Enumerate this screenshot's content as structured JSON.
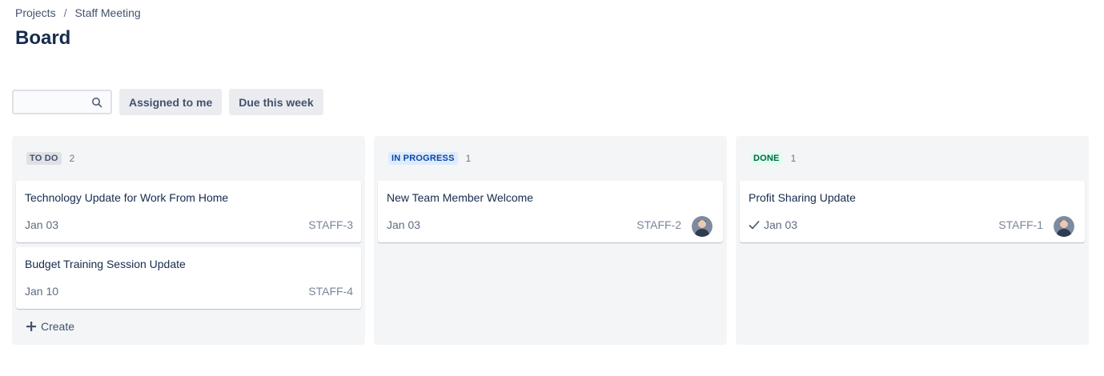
{
  "breadcrumb": {
    "projects": "Projects",
    "separator": "/",
    "project": "Staff Meeting"
  },
  "page_title": "Board",
  "toolbar": {
    "search_placeholder": "",
    "filter_assigned": "Assigned to me",
    "filter_due": "Due this week"
  },
  "columns": [
    {
      "name": "TO DO",
      "count": "2",
      "cards": [
        {
          "title": "Technology Update for Work From Home",
          "date": "Jan 03",
          "key": "STAFF-3"
        },
        {
          "title": "Budget Training Session Update",
          "date": "Jan 10",
          "key": "STAFF-4"
        }
      ],
      "create_label": "Create"
    },
    {
      "name": "IN PROGRESS",
      "count": "1",
      "cards": [
        {
          "title": "New Team Member Welcome",
          "date": "Jan 03",
          "key": "STAFF-2"
        }
      ]
    },
    {
      "name": "DONE",
      "count": "1",
      "cards": [
        {
          "title": "Profit Sharing Update",
          "date": "Jan 03",
          "key": "STAFF-1"
        }
      ]
    }
  ],
  "colors": {
    "column_bg": "#f4f5f7",
    "key_text": "#7a869a",
    "title_text": "#172b4d"
  }
}
